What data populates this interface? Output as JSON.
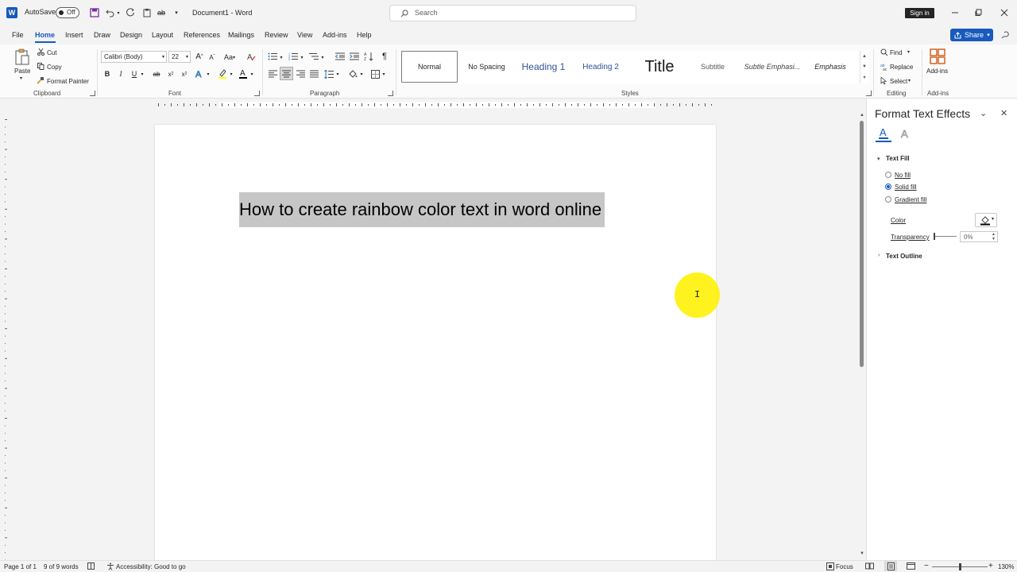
{
  "titlebar": {
    "autosave_label": "AutoSave",
    "autosave_state": "Off",
    "document_title": "Document1 - Word",
    "search_placeholder": "Search",
    "signin_label": "Sign in"
  },
  "tabs": [
    "File",
    "Home",
    "Insert",
    "Draw",
    "Design",
    "Layout",
    "References",
    "Mailings",
    "Review",
    "View",
    "Add-ins",
    "Help"
  ],
  "active_tab": "Home",
  "share_label": "Share",
  "clipboard": {
    "paste": "Paste",
    "cut": "Cut",
    "copy": "Copy",
    "format_painter": "Format Painter",
    "group_label": "Clipboard"
  },
  "font": {
    "font_name": "Calibri (Body)",
    "font_size": "22",
    "group_label": "Font"
  },
  "paragraph": {
    "group_label": "Paragraph"
  },
  "styles": {
    "items": [
      "Normal",
      "No Spacing",
      "Heading 1",
      "Heading 2",
      "Title",
      "Subtitle",
      "Subtle Emphasi...",
      "Emphasis"
    ],
    "selected": "Normal",
    "group_label": "Styles"
  },
  "editing": {
    "find": "Find",
    "replace": "Replace",
    "select": "Select",
    "group_label": "Editing"
  },
  "addins": {
    "button": "Add-ins",
    "group_label": "Add-ins"
  },
  "document": {
    "text": "How to create rainbow color text in word online"
  },
  "pane": {
    "title": "Format Text Effects",
    "text_fill_header": "Text Fill",
    "options": [
      "No fill",
      "Solid fill",
      "Gradient fill"
    ],
    "selected_option": "Solid fill",
    "color_label": "Color",
    "transparency_label": "Transparency",
    "transparency_value": "0%",
    "text_outline_header": "Text Outline"
  },
  "status": {
    "page": "Page 1 of 1",
    "words": "9 of 9 words",
    "accessibility": "Accessibility: Good to go",
    "focus": "Focus",
    "zoom": "130%"
  },
  "colors": {
    "accent": "#185abd",
    "highlight_cursor": "#fff000",
    "selection": "#c6c6c6"
  }
}
